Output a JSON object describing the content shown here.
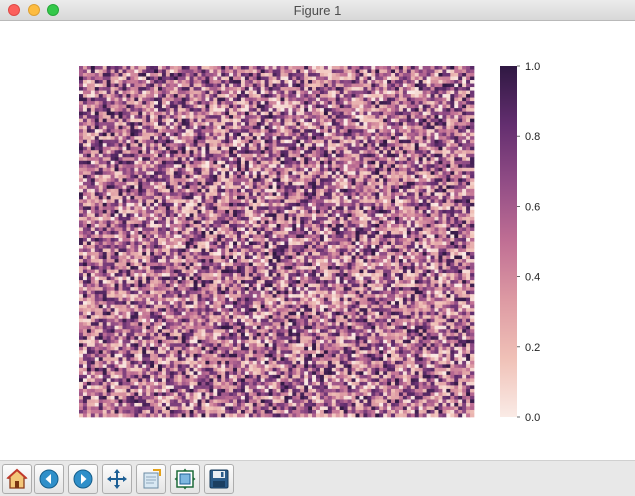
{
  "window": {
    "title": "Figure 1"
  },
  "toolbar": {
    "buttons": [
      {
        "name": "home",
        "icon": "home-icon"
      },
      {
        "name": "back",
        "icon": "back-arrow-icon"
      },
      {
        "name": "forward",
        "icon": "forward-arrow-icon"
      },
      {
        "name": "pan",
        "icon": "move-icon"
      },
      {
        "name": "zoom",
        "icon": "zoom-rect-icon"
      },
      {
        "name": "configure-subplots",
        "icon": "subplots-icon"
      },
      {
        "name": "save",
        "icon": "save-icon"
      }
    ]
  },
  "chart_data": {
    "type": "heatmap",
    "rows": 100,
    "cols": 100,
    "value_range": [
      0,
      1
    ],
    "values": "uniform random values between 0 and 1 (100x100 grid)",
    "xticks": [],
    "yticks": [],
    "colorbar": {
      "ticks": [
        "0.0",
        "0.2",
        "0.4",
        "0.6",
        "0.8",
        "1.0"
      ],
      "tick_values": [
        0,
        0.2,
        0.4,
        0.6,
        0.8,
        1.0
      ],
      "colormap": [
        "#faebe6",
        "#f0c1b7",
        "#dd9aa3",
        "#c06f94",
        "#924d86",
        "#632e6f",
        "#2f1842"
      ]
    },
    "grid": false,
    "legend": "colorbar-right"
  }
}
